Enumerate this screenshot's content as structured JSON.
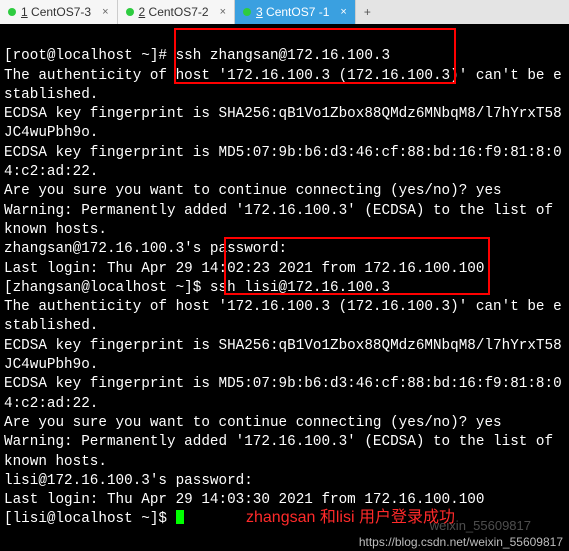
{
  "tabs": [
    {
      "dot": true,
      "num": "1",
      "label": "CentOS7-3",
      "active": false
    },
    {
      "dot": true,
      "num": "2",
      "label": "CentOS7-2",
      "active": false
    },
    {
      "dot": true,
      "num": "3",
      "label": "CentOS7 -1",
      "active": true
    }
  ],
  "tab_close": "×",
  "tab_add": "+",
  "term": {
    "l1_prompt": "[root@localhost ~]# ",
    "l1_cmd": "ssh zhangsan@172.16.100.3",
    "l2": "The authenticity of host '172.16.100.3 (172.16.100.3)' can't be established.",
    "l3": "ECDSA key fingerprint is SHA256:qB1Vo1Zbox88QMdz6MNbqM8/l7hYrxT58JC4wuPbh9o.",
    "l4": "ECDSA key fingerprint is MD5:07:9b:b6:d3:46:cf:88:bd:16:f9:81:8:04:c2:ad:22.",
    "l5": "Are you sure you want to continue connecting (yes/no)? yes",
    "l6": "Warning: Permanently added '172.16.100.3' (ECDSA) to the list of known hosts.",
    "l7": "zhangsan@172.16.100.3's password:",
    "l8": "Last login: Thu Apr 29 14:02:23 2021 from 172.16.100.100",
    "l9_prompt": "[zhangsan@localhost ~]$ ",
    "l9_cmd": "ssh lisi@172.16.100.3",
    "l10": "The authenticity of host '172.16.100.3 (172.16.100.3)' can't be established.",
    "l11": "ECDSA key fingerprint is SHA256:qB1Vo1Zbox88QMdz6MNbqM8/l7hYrxT58JC4wuPbh9o.",
    "l12": "ECDSA key fingerprint is MD5:07:9b:b6:d3:46:cf:88:bd:16:f9:81:8:04:c2:ad:22.",
    "l13": "Are you sure you want to continue connecting (yes/no)? yes",
    "l14": "Warning: Permanently added '172.16.100.3' (ECDSA) to the list of known hosts.",
    "l15": "lisi@172.16.100.3's password:",
    "l16": "Last login: Thu Apr 29 14:03:30 2021 from 172.16.100.100",
    "l17_prompt": "[lisi@localhost ~]$ "
  },
  "annotation": "zhangsan 和lisi 用户登录成功",
  "watermark_top": "weixin_55609817",
  "watermark": "https://blog.csdn.net/weixin_55609817"
}
